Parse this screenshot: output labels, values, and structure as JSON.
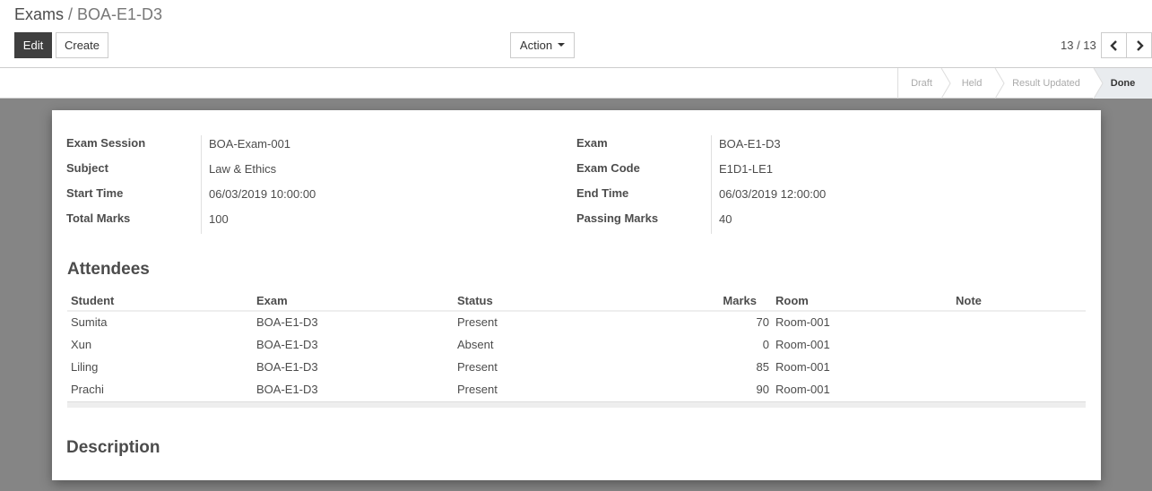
{
  "breadcrumb": {
    "parent": "Exams",
    "separator": "/",
    "current": "BOA-E1-D3"
  },
  "buttons": {
    "edit": "Edit",
    "create": "Create",
    "action": "Action"
  },
  "pager": {
    "value": "13 / 13"
  },
  "statusbar": {
    "stages": [
      "Draft",
      "Held",
      "Result Updated",
      "Done"
    ],
    "active": "Done"
  },
  "form": {
    "left": [
      {
        "label": "Exam Session",
        "value": "BOA-Exam-001"
      },
      {
        "label": "Subject",
        "value": "Law & Ethics"
      },
      {
        "label": "Start Time",
        "value": "06/03/2019 10:00:00"
      },
      {
        "label": "Total Marks",
        "value": "100"
      }
    ],
    "right": [
      {
        "label": "Exam",
        "value": "BOA-E1-D3"
      },
      {
        "label": "Exam Code",
        "value": "E1D1-LE1"
      },
      {
        "label": "End Time",
        "value": "06/03/2019 12:00:00"
      },
      {
        "label": "Passing Marks",
        "value": "40"
      }
    ]
  },
  "attendees": {
    "title": "Attendees",
    "columns": [
      "Student",
      "Exam",
      "Status",
      "Marks",
      "Room",
      "Note"
    ],
    "rows": [
      [
        "Sumita",
        "BOA-E1-D3",
        "Present",
        "70",
        "Room-001",
        ""
      ],
      [
        "Xun",
        "BOA-E1-D3",
        "Absent",
        "0",
        "Room-001",
        ""
      ],
      [
        "Liling",
        "BOA-E1-D3",
        "Present",
        "85",
        "Room-001",
        ""
      ],
      [
        "Prachi",
        "BOA-E1-D3",
        "Present",
        "90",
        "Room-001",
        ""
      ]
    ]
  },
  "description": {
    "title": "Description"
  },
  "colors": {
    "edit_button_bg": "#3f3f3f",
    "sheet_backdrop": "#858585",
    "active_stage_bg": "#e9ecef"
  }
}
